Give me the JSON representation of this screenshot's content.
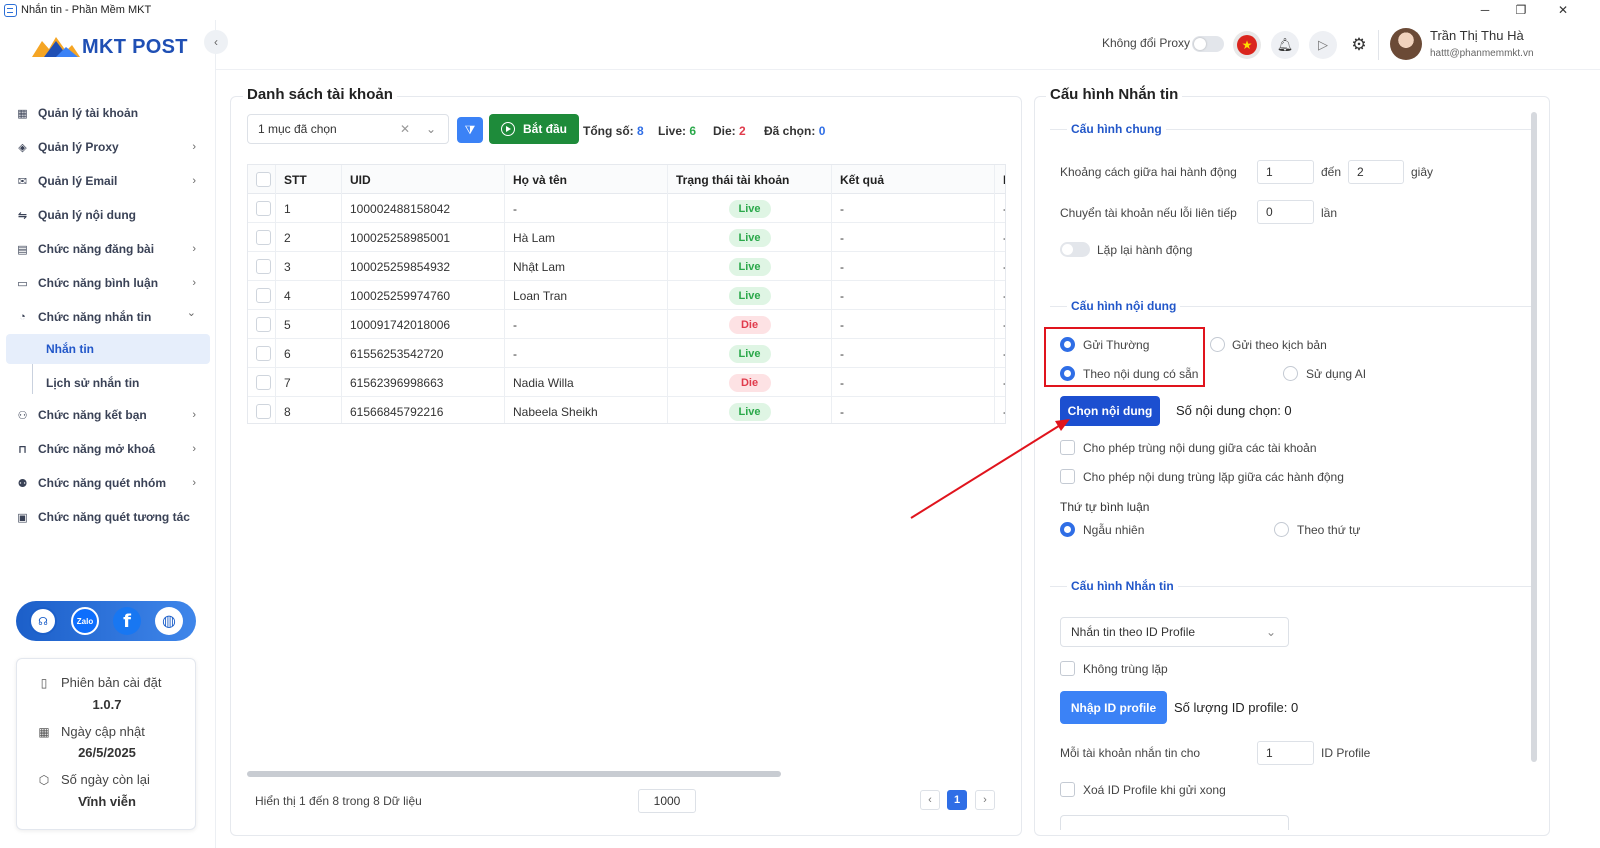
{
  "window": {
    "title": "Nhắn tin - Phần Mềm MKT",
    "min": "─",
    "restore": "❐",
    "close": "✕"
  },
  "logo": {
    "text": "MKT POST"
  },
  "sidebar": {
    "items": [
      {
        "label": "Quản lý tài khoản",
        "icon": "grid-icon",
        "chev": ""
      },
      {
        "label": "Quản lý Proxy",
        "icon": "layers-icon",
        "chev": "›"
      },
      {
        "label": "Quản lý Email",
        "icon": "mail-icon",
        "chev": "›"
      },
      {
        "label": "Quản lý nội dung",
        "icon": "content-icon",
        "chev": ""
      },
      {
        "label": "Chức năng đăng bài",
        "icon": "post-icon",
        "chev": "›"
      },
      {
        "label": "Chức năng bình luận",
        "icon": "comment-icon",
        "chev": "›"
      },
      {
        "label": "Chức năng nhắn tin",
        "icon": "chat-icon",
        "chev": "⌄"
      }
    ],
    "sub_items": [
      {
        "label": "Nhắn tin"
      },
      {
        "label": "Lịch sử nhắn tin"
      }
    ],
    "items2": [
      {
        "label": "Chức năng kết bạn",
        "icon": "add-friend-icon",
        "chev": "›"
      },
      {
        "label": "Chức năng mở khoá",
        "icon": "unlock-icon",
        "chev": "›"
      },
      {
        "label": "Chức năng quét nhóm",
        "icon": "group-icon",
        "chev": "›"
      },
      {
        "label": "Chức năng quét tương tác",
        "icon": "scan-icon",
        "chev": ""
      }
    ],
    "social": {
      "zalo": "Zalo",
      "facebook": "f"
    },
    "info": {
      "version_label": "Phiên bản cài đặt",
      "version": "1.0.7",
      "update_label": "Ngày cập nhật",
      "update": "26/5/2025",
      "remain_label": "Số ngày còn lại",
      "remain": "Vĩnh viễn"
    }
  },
  "header": {
    "proxy_label": "Không đổi Proxy",
    "user_name": "Trần Thị Thu Hà",
    "user_email": "hattt@phanmemmkt.vn"
  },
  "accounts": {
    "title": "Danh sách tài khoản",
    "select_value": "1 mục đã chọn",
    "start_label": "Bắt đầu",
    "stats": {
      "total_label": "Tổng số:",
      "total": "8",
      "live_label": "Live:",
      "live": "6",
      "die_label": "Die:",
      "die": "2",
      "selected_label": "Đã chọn:",
      "selected": "0"
    },
    "columns": {
      "stt": "STT",
      "uid": "UID",
      "name": "Họ và tên",
      "status": "Trạng thái tài khoản",
      "result": "Kết quả",
      "more": "I"
    },
    "rows": [
      {
        "stt": "1",
        "uid": "100002488158042",
        "name": "-",
        "status": "Live",
        "result": "-",
        "more": "-"
      },
      {
        "stt": "2",
        "uid": "100025258985001",
        "name": "Hà Lam",
        "status": "Live",
        "result": "-",
        "more": "-"
      },
      {
        "stt": "3",
        "uid": "100025259854932",
        "name": "Nhật Lam",
        "status": "Live",
        "result": "-",
        "more": "-"
      },
      {
        "stt": "4",
        "uid": "100025259974760",
        "name": "Loan Tran",
        "status": "Live",
        "result": "-",
        "more": "-"
      },
      {
        "stt": "5",
        "uid": "100091742018006",
        "name": "-",
        "status": "Die",
        "result": "-",
        "more": "-"
      },
      {
        "stt": "6",
        "uid": "61556253542720",
        "name": "-",
        "status": "Live",
        "result": "-",
        "more": "-"
      },
      {
        "stt": "7",
        "uid": "61562396998663",
        "name": "Nadia Willa",
        "status": "Die",
        "result": "-",
        "more": "-"
      },
      {
        "stt": "8",
        "uid": "61566845792216",
        "name": "Nabeela Sheikh",
        "status": "Live",
        "result": "-",
        "more": "-"
      }
    ],
    "footer": "Hiển thị 1 đến 8 trong 8 Dữ liệu",
    "page_size": "1000",
    "page": "1",
    "prev": "‹",
    "next": "›"
  },
  "config": {
    "title": "Cấu hình Nhắn tin",
    "general": {
      "title": "Cấu hình chung",
      "interval_label": "Khoảng cách giữa hai hành động",
      "interval_from": "1",
      "to_label": "đến",
      "interval_to": "2",
      "unit_sec": "giây",
      "switch_label": "Chuyển tài khoản nếu lỗi liên tiếp",
      "switch_value": "0",
      "unit_times": "lần",
      "repeat_label": "Lặp lại hành động"
    },
    "content": {
      "title": "Cấu hình nội dung",
      "send_normal": "Gửi Thường",
      "send_script": "Gửi theo kịch bản",
      "by_existing": "Theo nội dung có sẵn",
      "use_ai": "Sử dụng AI",
      "choose_btn": "Chọn nội dung",
      "count_label": "Số nội dung chọn: 0",
      "allow_dup_accounts": "Cho phép trùng nội dung giữa các tài khoản",
      "allow_dup_actions": "Cho phép nội dung trùng lặp giữa các hành động",
      "order_label": "Thứ tự bình luận",
      "random": "Ngẫu nhiên",
      "sequential": "Theo thứ tự"
    },
    "message": {
      "title": "Cấu hình Nhắn tin",
      "mode": "Nhắn tin theo ID Profile",
      "no_dup": "Không trùng lặp",
      "import_btn": "Nhập ID profile",
      "count_label": "Số lượng ID profile: 0",
      "per_account_label": "Mỗi tài khoản nhắn tin cho",
      "per_account_value": "1",
      "per_account_unit": "ID Profile",
      "delete_label": "Xoá ID Profile khi gửi xong"
    }
  },
  "colors": {
    "primary": "#2257c9",
    "start": "#1e8b3a",
    "live": "#2aa84a",
    "die": "#e03b4c",
    "annotation": "#e0141d"
  }
}
